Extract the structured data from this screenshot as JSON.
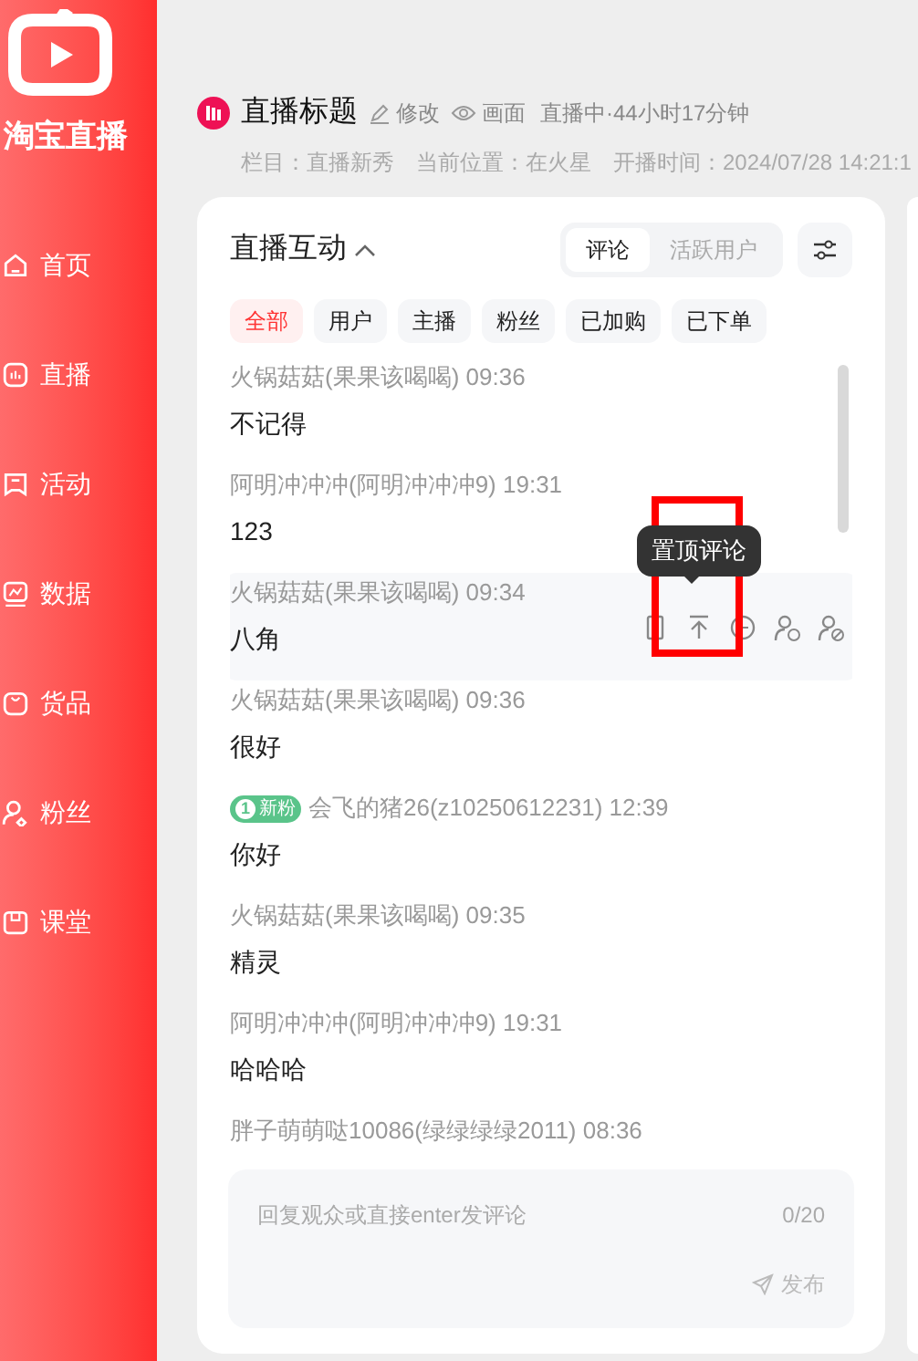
{
  "sidebar": {
    "logo_text": "淘宝直播",
    "items": [
      {
        "label": "首页",
        "kind": "home",
        "selected": false
      },
      {
        "label": "直播",
        "kind": "live",
        "selected": false
      },
      {
        "label": "活动",
        "kind": "activity",
        "selected": false
      },
      {
        "label": "数据",
        "kind": "data",
        "selected": false
      },
      {
        "label": "货品",
        "kind": "goods",
        "selected": false
      },
      {
        "label": "粉丝",
        "kind": "fans",
        "selected": false
      },
      {
        "label": "课堂",
        "kind": "class",
        "selected": false
      }
    ]
  },
  "header": {
    "title": "直播标题",
    "edit": "修改",
    "preview": "画面",
    "status": "直播中·44小时17分钟",
    "meta": [
      "栏目：直播新秀",
      "当前位置：在火星",
      "开播时间：2024/07/28 14:21:1"
    ]
  },
  "panel": {
    "title": "直播互动",
    "expanded": true,
    "tabs": [
      {
        "label": "评论",
        "selected": true
      },
      {
        "label": "活跃用户",
        "selected": false
      }
    ],
    "filters": [
      {
        "label": "全部",
        "selected": true
      },
      {
        "label": "用户",
        "selected": false
      },
      {
        "label": "主播",
        "selected": false
      },
      {
        "label": "粉丝",
        "selected": false
      },
      {
        "label": "已加购",
        "selected": false
      },
      {
        "label": "已下单",
        "selected": false
      }
    ],
    "comments": [
      {
        "user": "火锅菇菇(果果该喝喝) 09:36",
        "text": "不记得",
        "hovered": false
      },
      {
        "user": "阿明冲冲冲(阿明冲冲冲9) 19:31",
        "text": "123",
        "hovered": false
      },
      {
        "user": "火锅菇菇(果果该喝喝) 09:34",
        "text": "八角",
        "hovered": true
      },
      {
        "user": "火锅菇菇(果果该喝喝) 09:36",
        "text": "很好",
        "hovered": false
      },
      {
        "user": "会飞的猪26(z10250612231) 12:39",
        "text": "你好",
        "hovered": false,
        "badge": {
          "level": "1",
          "label": "新粉"
        }
      },
      {
        "user": "火锅菇菇(果果该喝喝) 09:35",
        "text": "精灵",
        "hovered": false
      },
      {
        "user": "阿明冲冲冲(阿明冲冲冲9) 19:31",
        "text": "哈哈哈",
        "hovered": false
      },
      {
        "user": "胖子萌萌哒10086(绿绿绿绿2011) 08:36",
        "hovered": false
      }
    ],
    "tooltip": "置顶评论",
    "reply": {
      "placeholder": "回复观众或直接enter发评论",
      "counter": "0/20",
      "send": "发布"
    }
  },
  "annotation": {
    "color": "#ff0000"
  }
}
